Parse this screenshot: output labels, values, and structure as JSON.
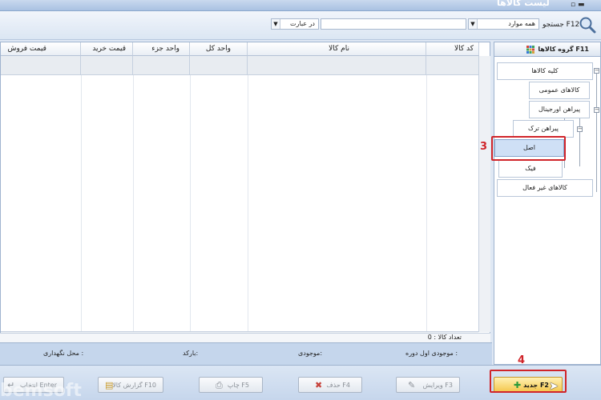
{
  "window": {
    "title": "لیست کالاها",
    "buttons": "▫ ▬"
  },
  "search": {
    "label": "جستجو F12",
    "scope_value": "همه موارد",
    "match_value": "در عبارت",
    "text_value": ""
  },
  "grid": {
    "columns": [
      "کد کالا",
      "نام کالا",
      "واحد کل",
      "واحد جزء",
      "قیمت خرید",
      "قیمت فروش"
    ],
    "count_label": "تعداد کالا : 0"
  },
  "info": {
    "opening_stock": "موجودی اول دوره :",
    "stock": "موجودی:",
    "barcode": "بارکد:",
    "location": "محل نگهداری :"
  },
  "tree": {
    "header": "گروه کالاها F11",
    "nodes": [
      "کلیه کالاها",
      "کالاهای عمومی",
      "پیراهن اورجینال",
      "پیراهن ترک",
      "اصل",
      "فیک",
      "کالاهای غیر فعال"
    ]
  },
  "markers": {
    "step3": "3",
    "step4": "4"
  },
  "toolbar": {
    "new": "جدید F2",
    "edit": "ویرایش F3",
    "delete": "حذف F4",
    "print": "چاپ F5",
    "report": "گزارش کالا F10",
    "select": "انتخاب Enter"
  },
  "watermark": "bemsoft",
  "colors": {
    "highlight": "#d0242a",
    "primary_button": "#f4c64a",
    "panel": "#c5d6ec"
  }
}
